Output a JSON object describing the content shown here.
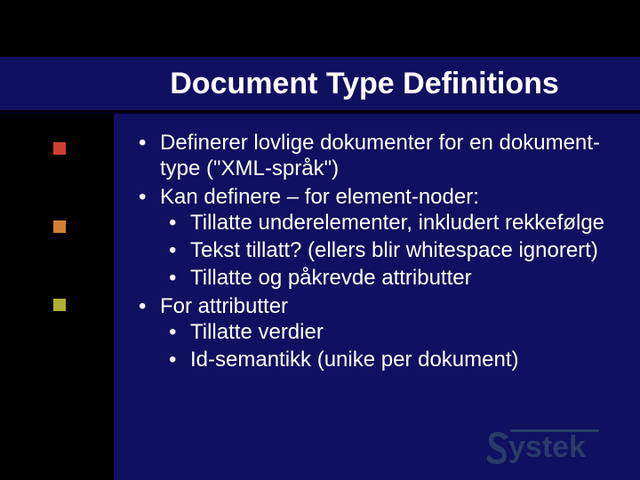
{
  "title": "Document Type Definitions",
  "bullets": {
    "b1": "Definerer lovlige dokumenter for en dokument-type (\"XML-språk\")",
    "b2": "Kan definere – for element-noder:",
    "b2_1": "Tillatte underelementer, inkludert rekkefølge",
    "b2_2": "Tekst tillatt? (ellers blir whitespace ignorert)",
    "b2_3": "Tillatte og påkrevde attributter",
    "b3": "For attributter",
    "b3_1": "Tillatte verdier",
    "b3_2": "Id-semantikk (unike per dokument)"
  },
  "logo_text": "Systek",
  "colors": {
    "body_bg": "#101060",
    "sq1": "#d04030",
    "sq2": "#d08030",
    "sq3": "#b0b030"
  }
}
